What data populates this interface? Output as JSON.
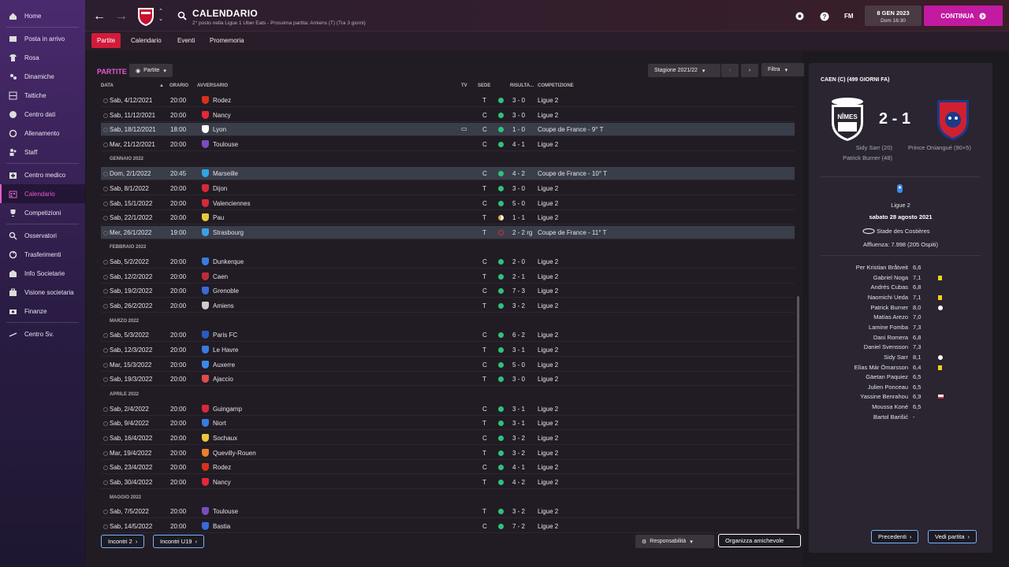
{
  "sidebar": {
    "items": [
      {
        "label": "Home",
        "icon": "home-icon"
      },
      {
        "label": "Posta in arrivo",
        "icon": "inbox-icon"
      },
      {
        "label": "Rosa",
        "icon": "shirt-icon"
      },
      {
        "label": "Dinamiche",
        "icon": "dynamics-icon"
      },
      {
        "label": "Tattiche",
        "icon": "tactics-icon"
      },
      {
        "label": "Centro dati",
        "icon": "data-icon"
      },
      {
        "label": "Allenamento",
        "icon": "training-icon"
      },
      {
        "label": "Staff",
        "icon": "staff-icon"
      },
      {
        "label": "Centro medico",
        "icon": "medical-icon"
      },
      {
        "label": "Calendario",
        "icon": "calendar-icon"
      },
      {
        "label": "Competizioni",
        "icon": "trophy-icon"
      },
      {
        "label": "Osservatori",
        "icon": "scout-icon"
      },
      {
        "label": "Trasferimenti",
        "icon": "transfer-icon"
      },
      {
        "label": "Info Societarie",
        "icon": "info-icon"
      },
      {
        "label": "Visione societaria",
        "icon": "vision-icon"
      },
      {
        "label": "Finanze",
        "icon": "finance-icon"
      },
      {
        "label": "Centro Sv.",
        "icon": "development-icon"
      }
    ]
  },
  "header": {
    "title": "CALENDARIO",
    "subtitle": "2° posto nella Ligue 1 Uber Eats - Prossima partita: Amiens (T) (Tra 3 giorni)",
    "fm": "FM",
    "date": "8 GEN 2023",
    "time": "Dom 16:30",
    "continue": "CONTINUA"
  },
  "tabs": [
    "Partite",
    "Calendario",
    "Eventi",
    "Promemoria"
  ],
  "list": {
    "heading": "PARTITE",
    "view_dropdown": "Partite",
    "season": "Stagione 2021/22",
    "filter": "Filtra",
    "columns": {
      "date": "DATA",
      "time": "ORARIO",
      "opponent": "AVVERSARIO",
      "tv": "TV",
      "venue": "SEDE",
      "result": "RISULTA...",
      "competition": "COMPETIZIONE"
    },
    "months": {
      "m1": "GENNAIO 2022",
      "m2": "FEBBRAIO 2022",
      "m3": "MARZO 2022",
      "m4": "APRILE 2022",
      "m5": "MAGGIO 2022"
    },
    "rows": [
      {
        "date": "Sab, 4/12/2021",
        "time": "20:00",
        "opp": "Rodez",
        "venue": "T",
        "res": "3 - 0",
        "comp": "Ligue 2",
        "color": "#d8301c",
        "status": "win"
      },
      {
        "date": "Sab, 11/12/2021",
        "time": "20:00",
        "opp": "Nancy",
        "venue": "C",
        "res": "3 - 0",
        "comp": "Ligue 2",
        "color": "#e2283a",
        "status": "win"
      },
      {
        "date": "Sab, 18/12/2021",
        "time": "18:00",
        "opp": "Lyon",
        "venue": "C",
        "res": "1 - 0",
        "comp": "Coupe de France - 9° T",
        "color": "#ffffff",
        "status": "win",
        "tv": true
      },
      {
        "date": "Mar, 21/12/2021",
        "time": "20:00",
        "opp": "Toulouse",
        "venue": "C",
        "res": "4 - 1",
        "comp": "Ligue 2",
        "color": "#7a4cc2",
        "status": "win"
      },
      {
        "date": "Dom, 2/1/2022",
        "time": "20:45",
        "opp": "Marseille",
        "venue": "C",
        "res": "4 - 2",
        "comp": "Coupe de France - 10° T",
        "color": "#2fa6e0",
        "status": "win"
      },
      {
        "date": "Sab, 8/1/2022",
        "time": "20:00",
        "opp": "Dijon",
        "venue": "T",
        "res": "3 - 0",
        "comp": "Ligue 2",
        "color": "#d8283a",
        "status": "win"
      },
      {
        "date": "Sab, 15/1/2022",
        "time": "20:00",
        "opp": "Valenciennes",
        "venue": "C",
        "res": "5 - 0",
        "comp": "Ligue 2",
        "color": "#d8283a",
        "status": "win"
      },
      {
        "date": "Sab, 22/1/2022",
        "time": "20:00",
        "opp": "Pau",
        "venue": "T",
        "res": "1 - 1",
        "comp": "Ligue 2",
        "color": "#e8c83a",
        "status": "draw"
      },
      {
        "date": "Mer, 26/1/2022",
        "time": "19:00",
        "opp": "Strasbourg",
        "venue": "T",
        "res": "2 - 2 rg",
        "comp": "Coupe de France - 11° T",
        "color": "#3aa0e8",
        "status": "loss"
      },
      {
        "date": "Sab, 5/2/2022",
        "time": "20:00",
        "opp": "Dunkerque",
        "venue": "C",
        "res": "2 - 0",
        "comp": "Ligue 2",
        "color": "#3a7ae0",
        "status": "win"
      },
      {
        "date": "Sab, 12/2/2022",
        "time": "20:00",
        "opp": "Caen",
        "venue": "T",
        "res": "2 - 1",
        "comp": "Ligue 2",
        "color": "#c22a3a",
        "status": "win"
      },
      {
        "date": "Sab, 19/2/2022",
        "time": "20:00",
        "opp": "Grenoble",
        "venue": "C",
        "res": "7 - 3",
        "comp": "Ligue 2",
        "color": "#3a6ad8",
        "status": "win"
      },
      {
        "date": "Sab, 26/2/2022",
        "time": "20:00",
        "opp": "Amiens",
        "venue": "T",
        "res": "3 - 2",
        "comp": "Ligue 2",
        "color": "#cccccc",
        "status": "win"
      },
      {
        "date": "Sab, 5/3/2022",
        "time": "20:00",
        "opp": "Paris FC",
        "venue": "C",
        "res": "6 - 2",
        "comp": "Ligue 2",
        "color": "#2a5ac2",
        "status": "win"
      },
      {
        "date": "Sab, 12/3/2022",
        "time": "20:00",
        "opp": "Le Havre",
        "venue": "T",
        "res": "3 - 1",
        "comp": "Ligue 2",
        "color": "#3a7ae0",
        "status": "win"
      },
      {
        "date": "Mar, 15/3/2022",
        "time": "20:00",
        "opp": "Auxerre",
        "venue": "C",
        "res": "5 - 0",
        "comp": "Ligue 2",
        "color": "#3a8ae8",
        "status": "win"
      },
      {
        "date": "Sab, 19/3/2022",
        "time": "20:00",
        "opp": "Ajaccio",
        "venue": "T",
        "res": "3 - 0",
        "comp": "Ligue 2",
        "color": "#e24a4a",
        "status": "win"
      },
      {
        "date": "Sab, 2/4/2022",
        "time": "20:00",
        "opp": "Guingamp",
        "venue": "C",
        "res": "3 - 1",
        "comp": "Ligue 2",
        "color": "#d8283a",
        "status": "win"
      },
      {
        "date": "Sab, 9/4/2022",
        "time": "20:00",
        "opp": "Niort",
        "venue": "T",
        "res": "3 - 1",
        "comp": "Ligue 2",
        "color": "#3a7ae0",
        "status": "win"
      },
      {
        "date": "Sab, 16/4/2022",
        "time": "20:00",
        "opp": "Sochaux",
        "venue": "C",
        "res": "3 - 2",
        "comp": "Ligue 2",
        "color": "#e8c83a",
        "status": "win"
      },
      {
        "date": "Mar, 19/4/2022",
        "time": "20:00",
        "opp": "Quevilly-Rouen",
        "venue": "T",
        "res": "3 - 2",
        "comp": "Ligue 2",
        "color": "#e8802a",
        "status": "win"
      },
      {
        "date": "Sab, 23/4/2022",
        "time": "20:00",
        "opp": "Rodez",
        "venue": "C",
        "res": "4 - 1",
        "comp": "Ligue 2",
        "color": "#d8301c",
        "status": "win"
      },
      {
        "date": "Sab, 30/4/2022",
        "time": "20:00",
        "opp": "Nancy",
        "venue": "T",
        "res": "4 - 2",
        "comp": "Ligue 2",
        "color": "#e2283a",
        "status": "win"
      },
      {
        "date": "Sab, 7/5/2022",
        "time": "20:00",
        "opp": "Toulouse",
        "venue": "T",
        "res": "3 - 2",
        "comp": "Ligue 2",
        "color": "#7a4cc2",
        "status": "win"
      },
      {
        "date": "Sab, 14/5/2022",
        "time": "20:00",
        "opp": "Bastia",
        "venue": "C",
        "res": "7 - 2",
        "comp": "Ligue 2",
        "color": "#3a6ad8",
        "status": "win"
      }
    ],
    "footer": {
      "matches": "Incontri 2",
      "u19": "Incontri U19",
      "responsibility": "Responsabilità",
      "friendly": "Organizza amichevole"
    }
  },
  "match": {
    "title": "CAEN (C) (499 GIORNI FA)",
    "home_crest_text": "NÎMES",
    "score": "2 - 1",
    "home_scorers": [
      "Sidy Sarr (20)",
      "Patrick Burner (48)"
    ],
    "away_scorers": [
      "Prince Oniangué (90+5)"
    ],
    "competition": "Ligue 2",
    "date": "sabato 28 agosto 2021",
    "stadium": "Stade des Costières",
    "attendance": "Affluenza: 7.998 (205 Ospiti)",
    "players": [
      {
        "name": "Per Kristian Bråtveit",
        "rating": "6,6",
        "event": ""
      },
      {
        "name": "Gabriel Noga",
        "rating": "7,1",
        "event": "yellow"
      },
      {
        "name": "Andrés Cubas",
        "rating": "6,8",
        "event": ""
      },
      {
        "name": "Naomichi Ueda",
        "rating": "7,1",
        "event": "yellow"
      },
      {
        "name": "Patrick Burner",
        "rating": "8,0",
        "event": "goal"
      },
      {
        "name": "Matías Arezo",
        "rating": "7,0",
        "event": ""
      },
      {
        "name": "Lamine Fomba",
        "rating": "7,3",
        "event": ""
      },
      {
        "name": "Dani Romera",
        "rating": "6,8",
        "event": ""
      },
      {
        "name": "Daniel Svensson",
        "rating": "7,3",
        "event": ""
      },
      {
        "name": "Sidy Sarr",
        "rating": "8,1",
        "event": "goal"
      },
      {
        "name": "Elías Már Ómarsson",
        "rating": "6,4",
        "event": "yellow"
      },
      {
        "name": "Gäetan Paquiez",
        "rating": "6,5",
        "event": ""
      },
      {
        "name": "Julien Ponceau",
        "rating": "6,5",
        "event": ""
      },
      {
        "name": "Yassine Benrahou",
        "rating": "6,9",
        "event": "sub"
      },
      {
        "name": "Moussa Koné",
        "rating": "6,5",
        "event": ""
      },
      {
        "name": "Bartol Barišić",
        "rating": "-",
        "event": ""
      }
    ],
    "prev": "Precedenti",
    "view": "Vedi partita"
  },
  "colors": {
    "accent": "#c21aa0",
    "tab_active": "#d21b3a",
    "win": "#2fc27a",
    "draw": "#e8a83a",
    "loss": "#d8303a"
  }
}
